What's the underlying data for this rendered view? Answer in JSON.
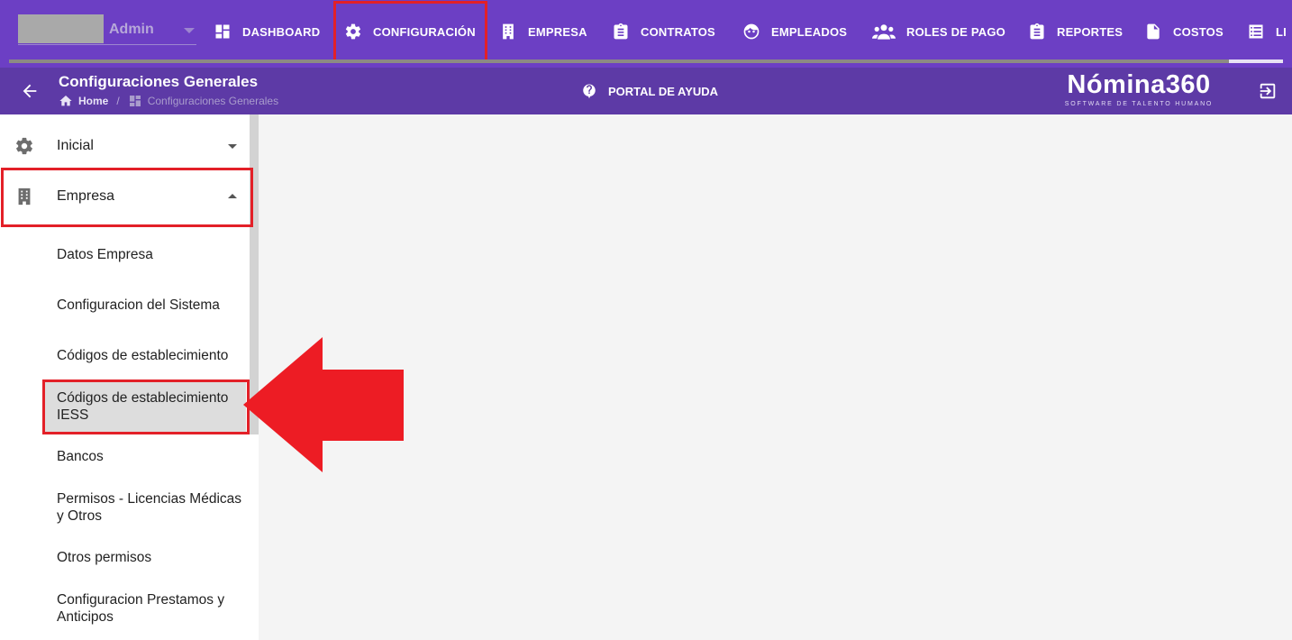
{
  "user": {
    "name": "Admin"
  },
  "nav": {
    "items": [
      {
        "label": "DASHBOARD",
        "icon": "dashboard-icon"
      },
      {
        "label": "CONFIGURACIÓN",
        "icon": "gear-icon"
      },
      {
        "label": "EMPRESA",
        "icon": "building-icon"
      },
      {
        "label": "CONTRATOS",
        "icon": "clipboard-icon"
      },
      {
        "label": "EMPLEADOS",
        "icon": "face-icon"
      },
      {
        "label": "ROLES DE PAGO",
        "icon": "people-icon"
      },
      {
        "label": "REPORTES",
        "icon": "clipboard-icon"
      },
      {
        "label": "COSTOS",
        "icon": "invoice-icon"
      },
      {
        "label": "LI",
        "icon": "list-icon"
      }
    ]
  },
  "header": {
    "title": "Configuraciones Generales",
    "breadcrumb_home": "Home",
    "breadcrumb_separator": "/",
    "breadcrumb_current": "Configuraciones Generales",
    "help_label": "PORTAL DE AYUDA",
    "logo_main": "Nómina360",
    "logo_sub": "SOFTWARE DE TALENTO HUMANO"
  },
  "sidebar": {
    "inicial_label": "Inicial",
    "empresa_label": "Empresa",
    "sub_items": [
      "Datos Empresa",
      "Configuracion del Sistema",
      "Códigos de establecimiento",
      "Códigos de establecimiento IESS",
      "Bancos",
      "Permisos - Licencias Médicas y Otros",
      "Otros permisos",
      "Configuracion Prestamos y Anticipos"
    ],
    "active_sub_index": 3
  },
  "colors": {
    "nav_bg": "#6c3fc4",
    "header_bg": "#5d3aa6",
    "highlight_red": "#e32028",
    "content_bg": "#f4f4f4"
  }
}
